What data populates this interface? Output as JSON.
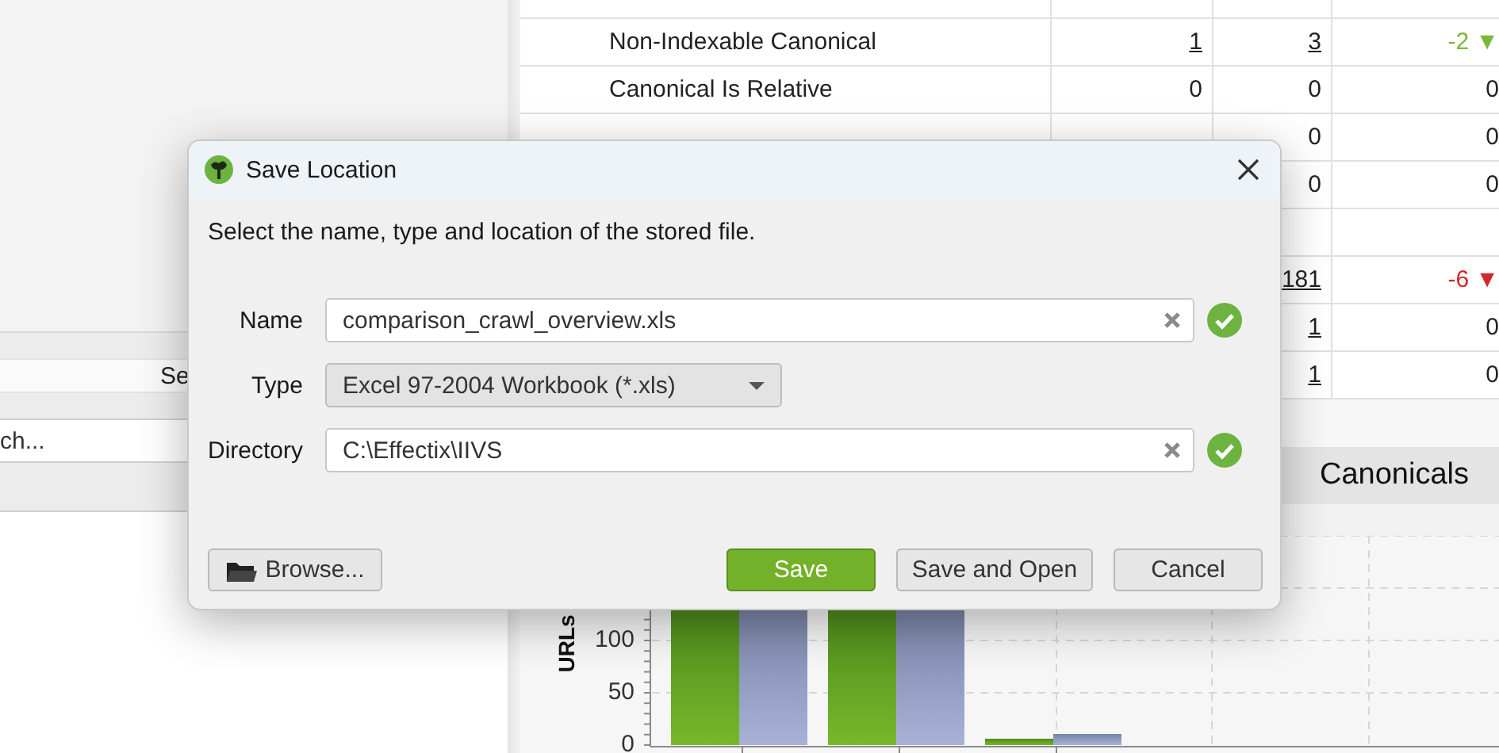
{
  "left_panel": {
    "bar_label": "Se",
    "search": {
      "placeholder": "ch..."
    }
  },
  "table": {
    "rows": [
      {},
      {
        "label": "Non-Indexable Canonical",
        "column_2": {
          "text": "1",
          "link": true
        },
        "column_3": {
          "text": "3",
          "link": true
        },
        "column_4": {
          "text": "-2",
          "arrow": "▼",
          "color": "#7cb83a"
        }
      },
      {
        "label": "Canonical Is Relative",
        "column_2": {
          "text": "0",
          "link": false
        },
        "column_3": {
          "text": "0",
          "link": false
        },
        "column_4": {
          "text": "0"
        }
      },
      {
        "column_3": {
          "text": "0",
          "link": false
        },
        "column_4": {
          "text": "0"
        }
      },
      {
        "column_3": {
          "text": "0",
          "link": false
        },
        "column_4": {
          "text": "0"
        }
      },
      {},
      {
        "column_3": {
          "text": "181",
          "link": true
        },
        "column_4": {
          "text": "-6",
          "arrow": "▼",
          "color": "#d0282c"
        }
      },
      {
        "column_3": {
          "text": "1",
          "link": true
        },
        "column_4": {
          "text": "0"
        }
      },
      {
        "column_3": {
          "text": "1",
          "link": true
        },
        "column_4": {
          "text": "0"
        }
      }
    ]
  },
  "chart_panel": {
    "tab": "Canonicals",
    "ylabel": "URLs",
    "yticks": [
      "100",
      "50",
      "0"
    ]
  },
  "dialog": {
    "title": "Save Location",
    "description": "Select the name, type and location of the stored file.",
    "fields": [
      {
        "kind": "text",
        "label": "Name",
        "value": "comparison_crawl_overview.xls",
        "valid": true
      },
      {
        "kind": "select",
        "label": "Type",
        "value": "Excel 97-2004 Workbook (*.xls)"
      },
      {
        "kind": "text",
        "label": "Directory",
        "value": "C:\\Effectix\\IIVS",
        "valid": true
      }
    ],
    "buttons": [
      {
        "kind": "browse",
        "label": "Browse..."
      },
      {
        "kind": "primary",
        "label": "Save"
      },
      {
        "kind": "normal",
        "label": "Save and Open"
      },
      {
        "kind": "normal",
        "label": "Cancel"
      }
    ]
  }
}
